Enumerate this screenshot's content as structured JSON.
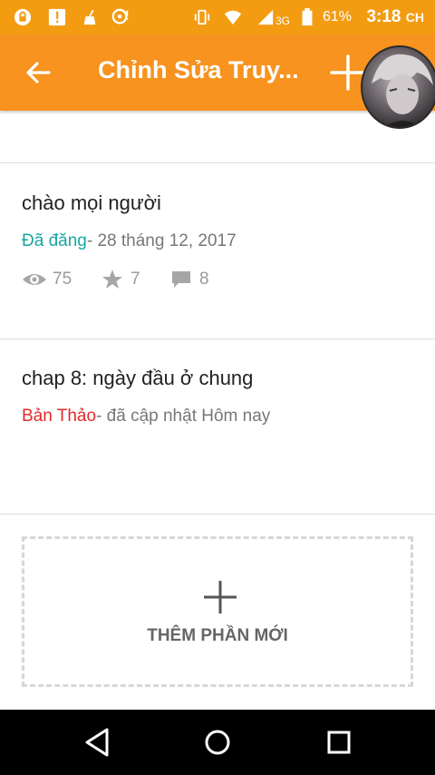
{
  "status_bar": {
    "network": "3G",
    "battery": "61%",
    "time": "3:18",
    "time_suffix": "CH"
  },
  "app_bar": {
    "title": "Chỉnh Sửa Truy..."
  },
  "parts": [
    {
      "title": "chào mọi người",
      "status": "Đã đăng",
      "detail": "- 28 tháng 12, 2017",
      "views": "75",
      "votes": "7",
      "comments": "8"
    },
    {
      "title": "chap 8: ngày đầu ở chung",
      "status": "Bản Thảo",
      "detail": "- đã cập nhật Hôm nay"
    }
  ],
  "add_part": {
    "label": "THÊM PHẦN MỚI"
  },
  "colors": {
    "accent": "#f7931e",
    "published": "#18a6a0",
    "draft": "#e02a2a"
  }
}
